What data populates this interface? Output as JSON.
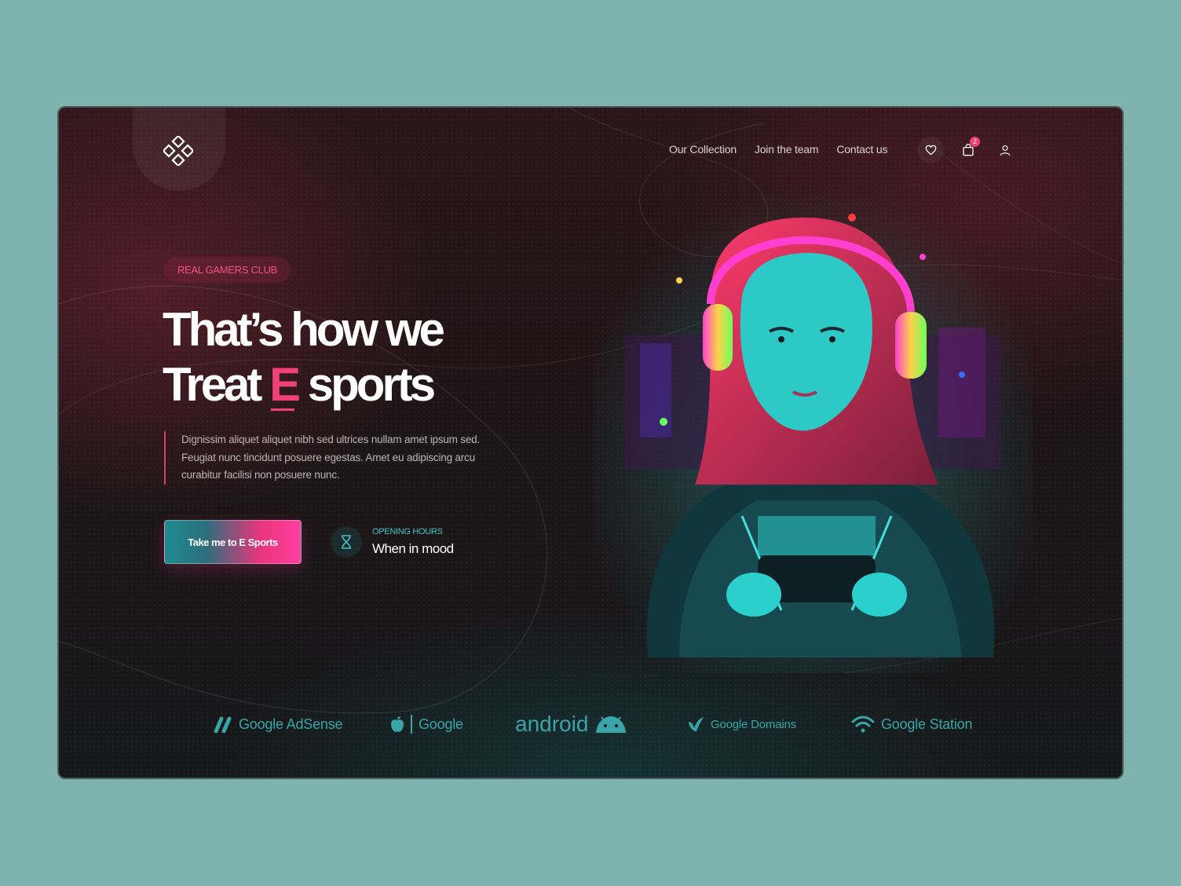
{
  "nav": {
    "links": [
      "Our Collection",
      "Join the team",
      "Contact us"
    ],
    "cart_count": "2"
  },
  "hero": {
    "pill": "REAL GAMERS CLUB",
    "headline_line1": "That’s how we",
    "headline_line2_prefix": "Treat ",
    "headline_accent": "E",
    "headline_line2_suffix": " sports",
    "description": "Dignissim aliquet aliquet nibh sed ultrices nullam amet ipsum sed. Feugiat nunc tincidunt posuere egestas. Amet eu adipiscing arcu curabitur facilisi non posuere nunc.",
    "cta_label": "Take me to E Sports",
    "hours_label": "OPENING HOURS",
    "hours_value": "When in mood"
  },
  "partners": [
    {
      "name": "Google AdSense",
      "icon": "adsense-icon"
    },
    {
      "name": "Google",
      "icon": "apple-icon"
    },
    {
      "name": "android",
      "icon": "android-icon"
    },
    {
      "name": "Google Domains",
      "icon": "domains-icon"
    },
    {
      "name": "Google Station",
      "icon": "wifi-icon"
    }
  ],
  "colors": {
    "page_bg": "#7fb3ae",
    "accent_pink": "#f0417b",
    "accent_teal": "#3fc6c4"
  }
}
